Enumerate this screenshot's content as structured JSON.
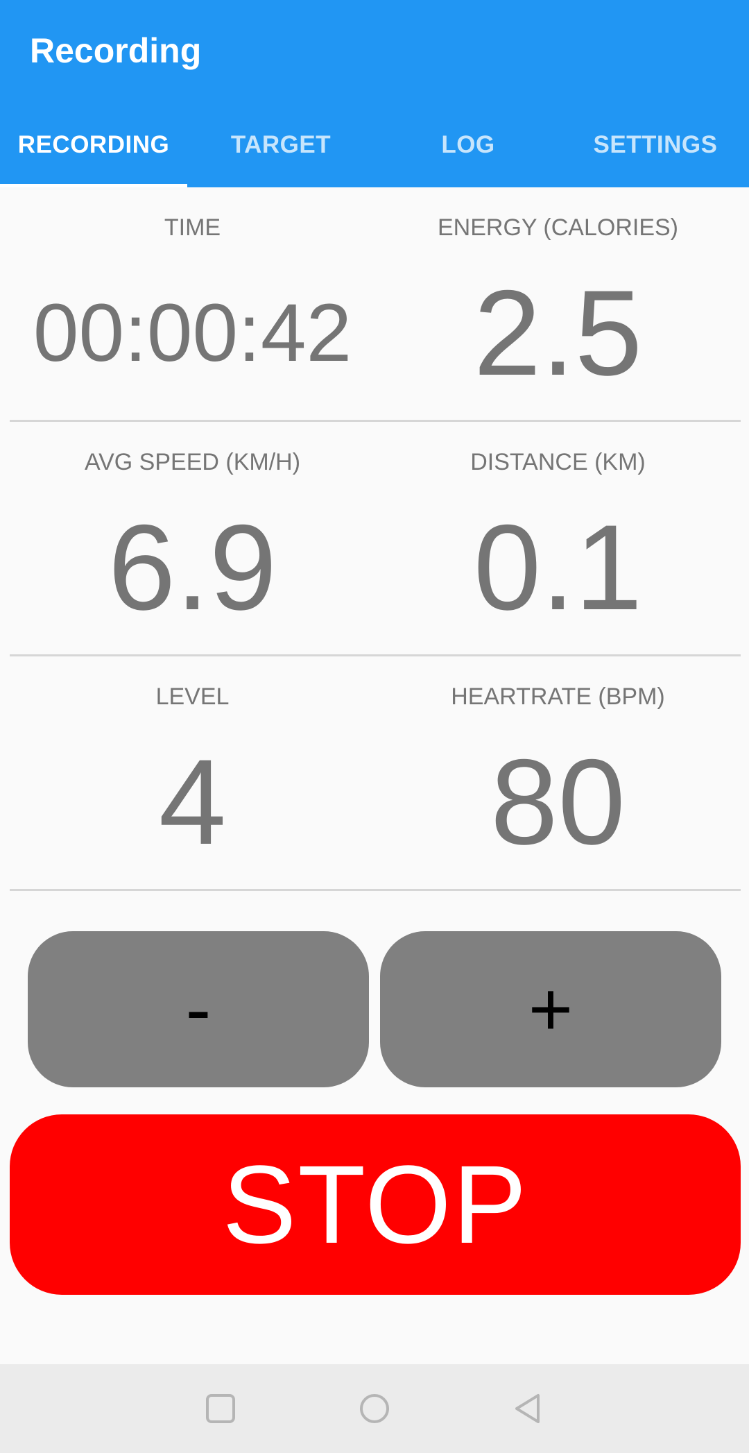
{
  "app_bar": {
    "title": "Recording",
    "color": "#2196f3"
  },
  "tabs": [
    {
      "label": "RECORDING",
      "active": true
    },
    {
      "label": "TARGET",
      "active": false
    },
    {
      "label": "LOG",
      "active": false
    },
    {
      "label": "SETTINGS",
      "active": false
    }
  ],
  "metrics": {
    "time": {
      "label": "TIME",
      "value": "00:00:42"
    },
    "energy": {
      "label": "ENERGY (CALORIES)",
      "value": "2.5"
    },
    "avg_speed": {
      "label": "AVG SPEED (KM/H)",
      "value": "6.9"
    },
    "distance": {
      "label": "DISTANCE (KM)",
      "value": "0.1"
    },
    "level": {
      "label": "LEVEL",
      "value": "4"
    },
    "heartrate": {
      "label": "HEARTRATE (BPM)",
      "value": "80"
    }
  },
  "controls": {
    "decrease_label": "-",
    "increase_label": "+",
    "stop_label": "STOP",
    "stop_color": "#ff0000",
    "level_button_color": "#808080"
  },
  "nav_bar": {
    "icons": [
      "recents-square-icon",
      "home-circle-icon",
      "back-triangle-icon"
    ]
  }
}
